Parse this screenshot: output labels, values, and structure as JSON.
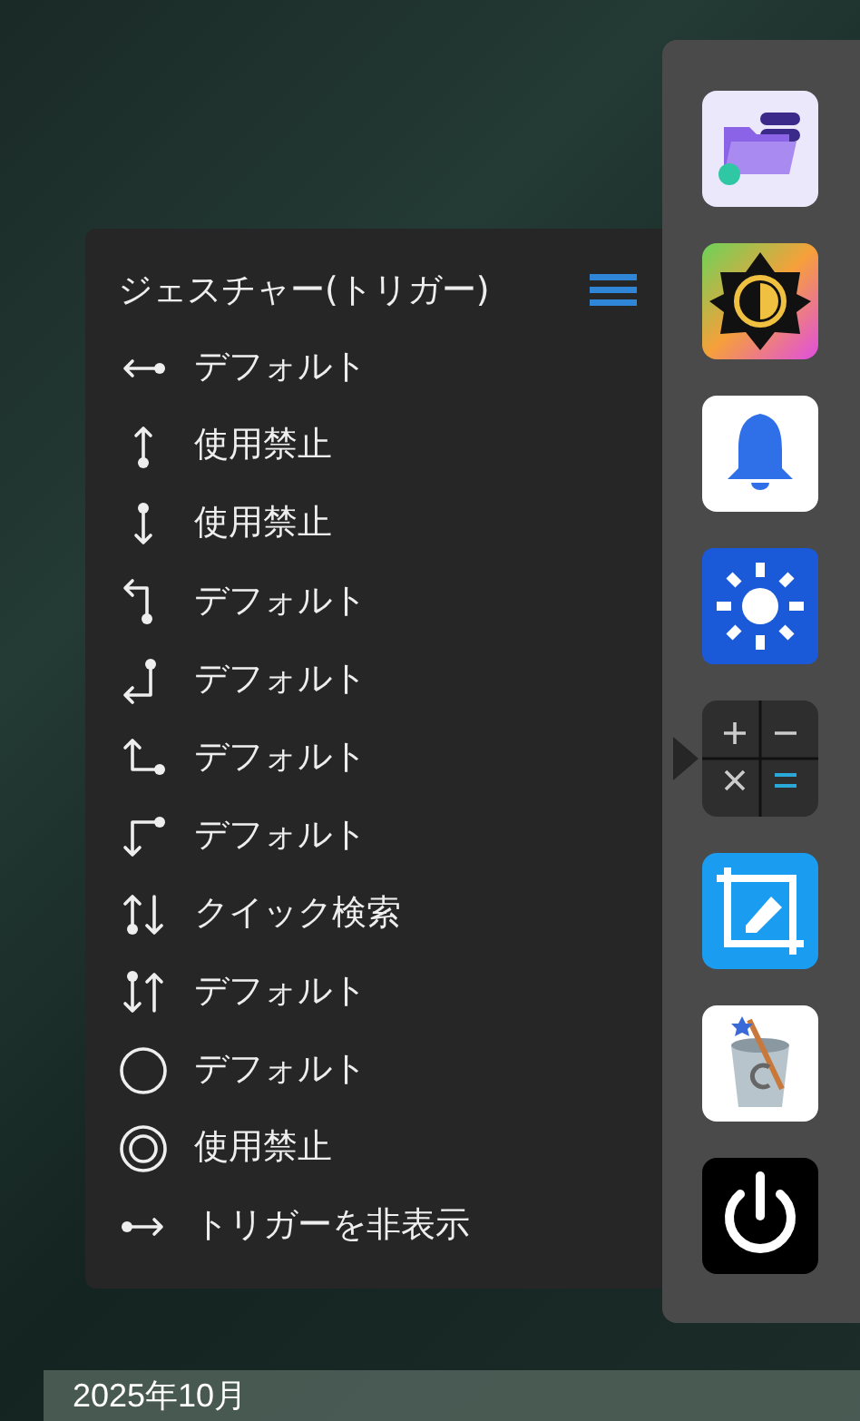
{
  "menu": {
    "title": "ジェスチャー(トリガー)",
    "items": [
      {
        "label": "デフォルト"
      },
      {
        "label": "使用禁止"
      },
      {
        "label": "使用禁止"
      },
      {
        "label": "デフォルト"
      },
      {
        "label": "デフォルト"
      },
      {
        "label": "デフォルト"
      },
      {
        "label": "デフォルト"
      },
      {
        "label": "クイック検索"
      },
      {
        "label": "デフォルト"
      },
      {
        "label": "デフォルト"
      },
      {
        "label": "使用禁止"
      },
      {
        "label": "トリガーを非表示"
      }
    ]
  },
  "sidebar": {
    "apps": [
      {
        "selected": false
      },
      {
        "selected": false
      },
      {
        "selected": false
      },
      {
        "selected": false
      },
      {
        "selected": true
      },
      {
        "selected": false
      },
      {
        "selected": false
      },
      {
        "selected": false
      }
    ]
  },
  "date_bar": {
    "text": "2025年10月"
  }
}
